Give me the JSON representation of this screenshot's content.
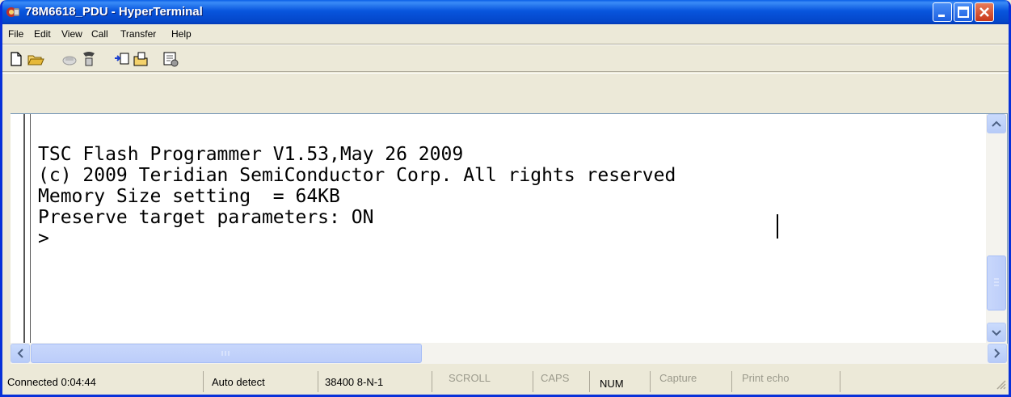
{
  "window": {
    "title": "78M6618_PDU - HyperTerminal"
  },
  "menubar": [
    {
      "label": "File"
    },
    {
      "label": "Edit"
    },
    {
      "label": "View"
    },
    {
      "label": "Call"
    },
    {
      "label": "Transfer"
    },
    {
      "label": "Help"
    }
  ],
  "toolbar": [
    "new-document-icon",
    "open-folder-icon",
    "disconnect-phone-icon",
    "call-icon",
    "send-icon",
    "receive-icon",
    "properties-icon"
  ],
  "terminal": {
    "lines": [
      "TSC Flash Programmer V1.53,May 26 2009",
      "(c) 2009 Teridian SemiConductor Corp. All rights reserved",
      "Memory Size setting  = 64KB",
      "Preserve target parameters: ON",
      ">"
    ]
  },
  "status": {
    "connected": "Connected 0:04:44",
    "detect": "Auto detect",
    "settings": "38400 8-N-1",
    "scroll": "SCROLL",
    "caps": "CAPS",
    "num": "NUM",
    "capture": "Capture",
    "print_echo": "Print echo"
  }
}
